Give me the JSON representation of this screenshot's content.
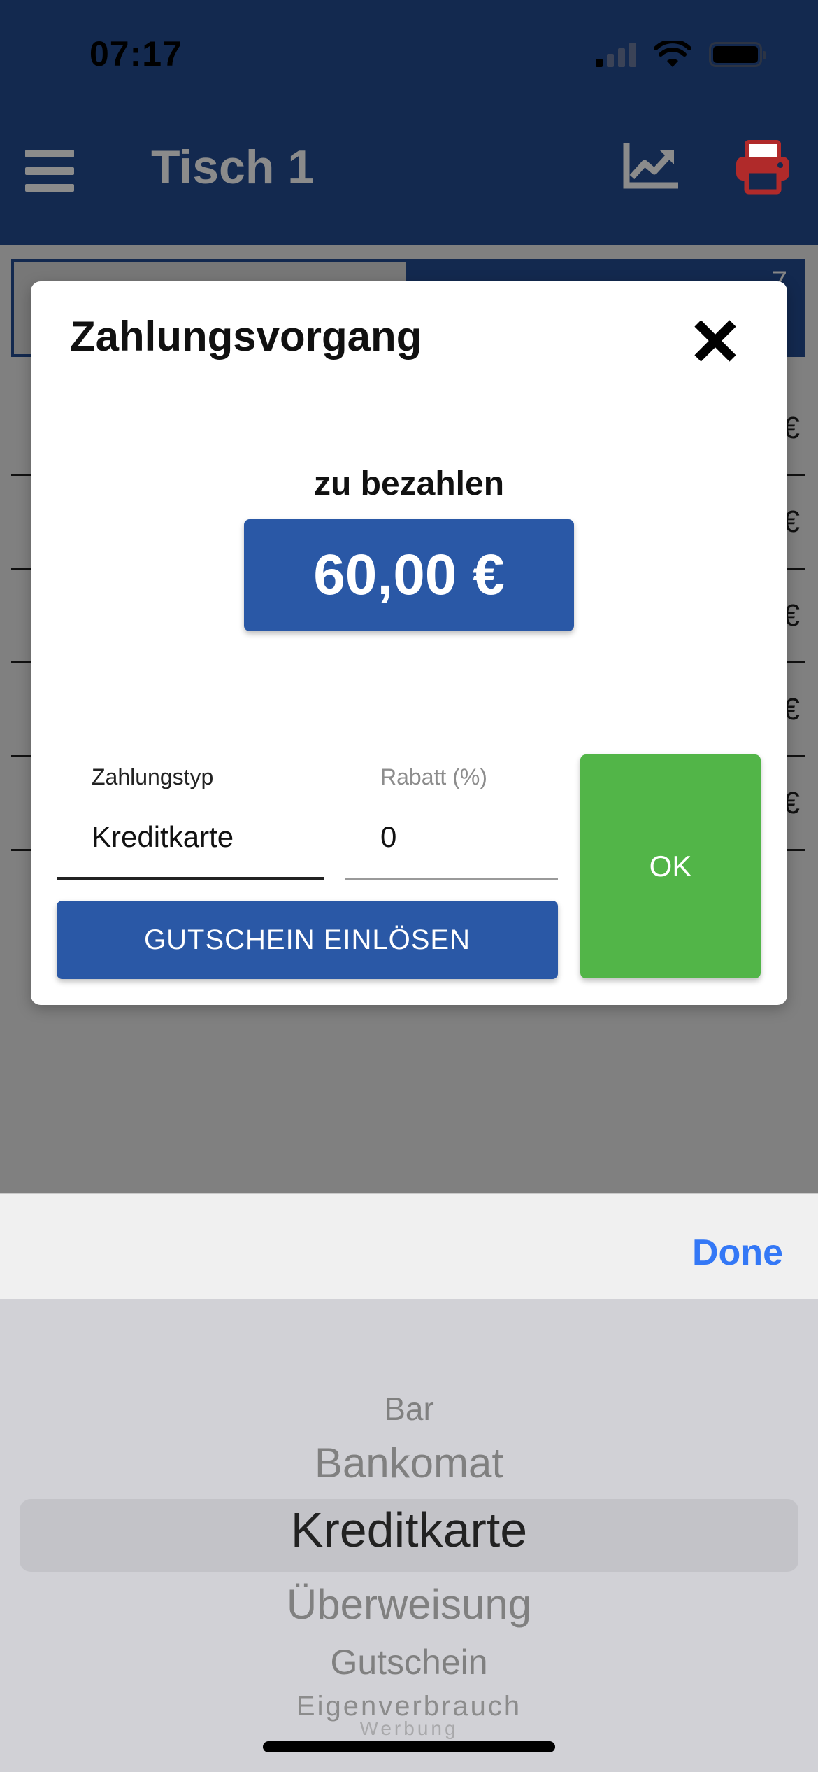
{
  "status_bar": {
    "time": "07:17"
  },
  "header": {
    "title": "Tisch 1"
  },
  "background": {
    "tab_badge": "7",
    "row_currency": "€"
  },
  "dialog": {
    "title": "Zahlungsvorgang",
    "due_label": "zu bezahlen",
    "amount": "60,00 €",
    "payment_type": {
      "label": "Zahlungstyp",
      "value": "Kreditkarte"
    },
    "discount": {
      "label": "Rabatt (%)",
      "value": "0"
    },
    "voucher_label": "GUTSCHEIN EINLÖSEN",
    "ok_label": "OK"
  },
  "picker": {
    "done_label": "Done",
    "options": [
      "Bar",
      "Bankomat",
      "Kreditkarte",
      "Überweisung",
      "Gutschein",
      "Eigenverbrauch",
      "Werbung"
    ],
    "selected": "Kreditkarte"
  },
  "colors": {
    "header_bg": "#13294f",
    "primary_button": "#2a58a6",
    "ok_button": "#52b548",
    "printer_icon": "#b02a2a",
    "done_text": "#3478f6"
  }
}
